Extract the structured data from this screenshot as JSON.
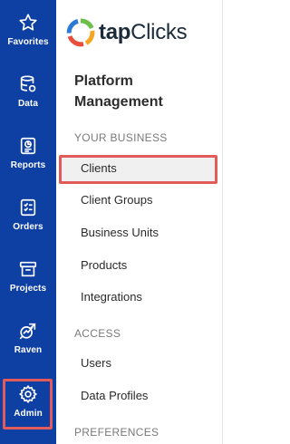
{
  "rail": {
    "items": [
      {
        "label": "Favorites",
        "icon": "star-icon"
      },
      {
        "label": "Data",
        "icon": "database-icon"
      },
      {
        "label": "Reports",
        "icon": "report-icon"
      },
      {
        "label": "Orders",
        "icon": "orders-icon"
      },
      {
        "label": "Projects",
        "icon": "projects-icon"
      },
      {
        "label": "Raven",
        "icon": "raven-icon"
      },
      {
        "label": "Admin",
        "icon": "gear-icon"
      }
    ],
    "active": "Admin"
  },
  "logo": {
    "bold": "tap",
    "rest": "Clicks"
  },
  "panel": {
    "title": "Platform Management",
    "sections": [
      {
        "heading": "YOUR BUSINESS",
        "items": [
          "Clients",
          "Client Groups",
          "Business Units",
          "Products",
          "Integrations"
        ]
      },
      {
        "heading": "ACCESS",
        "items": [
          "Users",
          "Data Profiles"
        ]
      },
      {
        "heading": "PREFERENCES",
        "items": []
      }
    ],
    "selected": "Clients"
  },
  "colors": {
    "rail": "#0e3fa3",
    "highlight": "#e25b5b",
    "selected_bg": "#f0f0f0"
  }
}
